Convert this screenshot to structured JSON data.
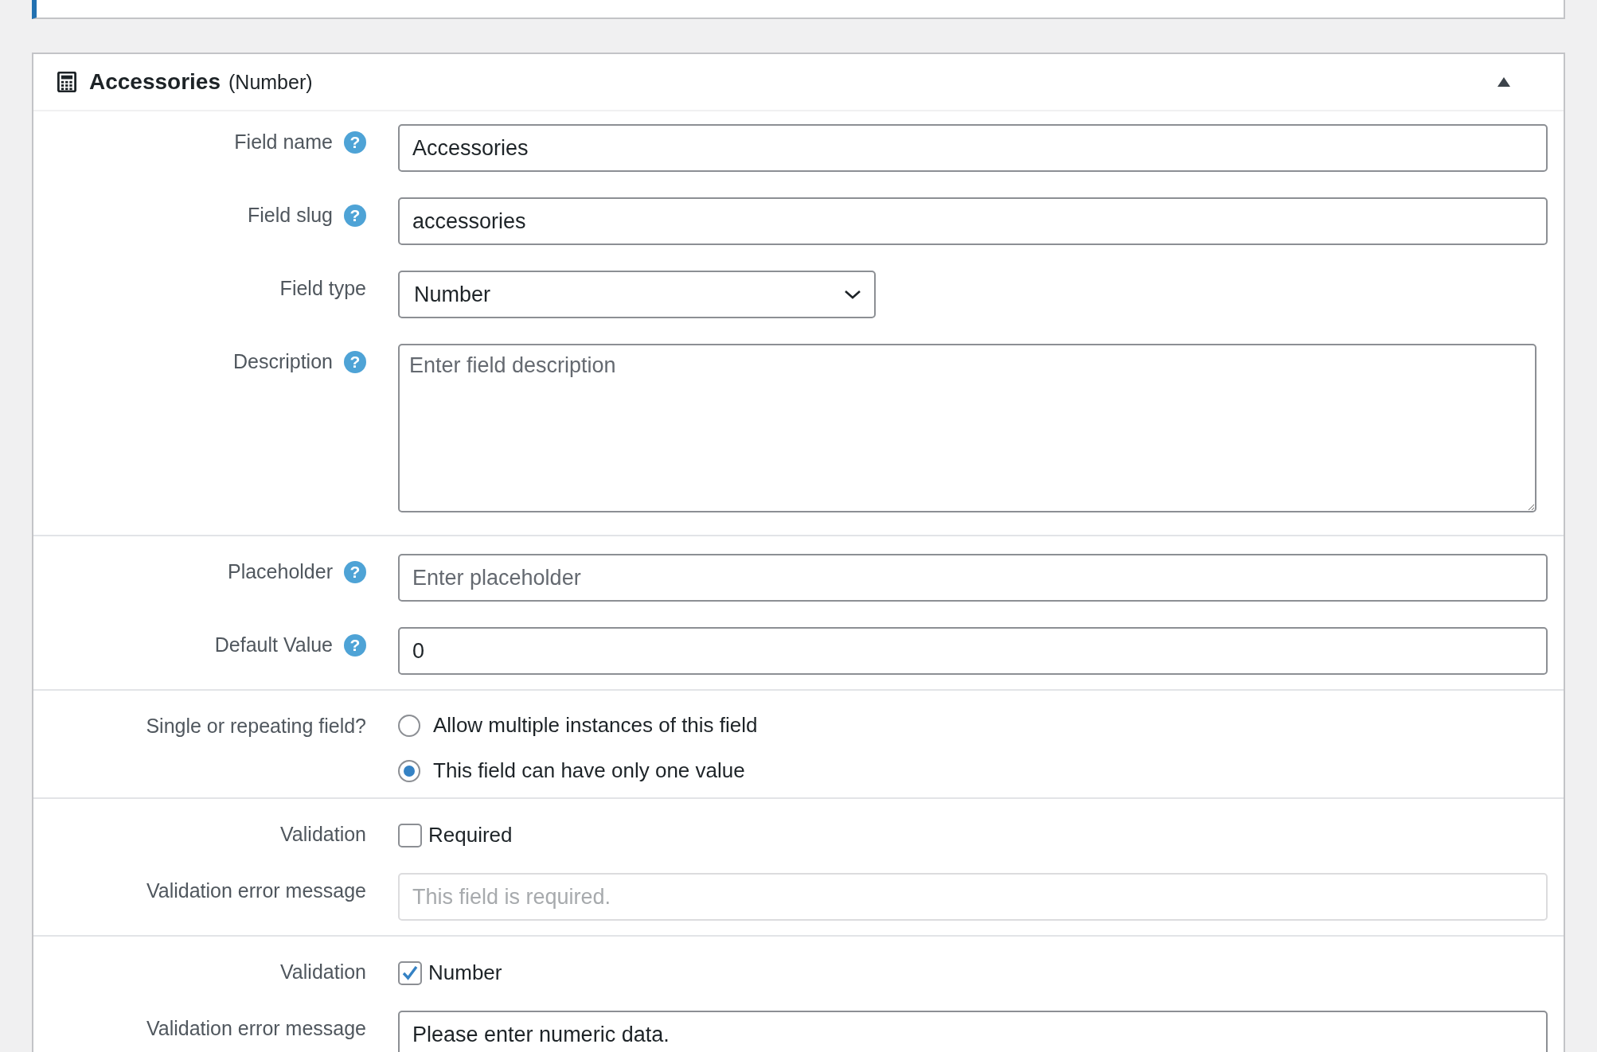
{
  "panel": {
    "title": "Accessories",
    "type_label": "(Number)",
    "expanded": true
  },
  "sections": [
    {
      "rows": [
        {
          "kind": "text",
          "label": "Field name",
          "help": "?",
          "value": "Accessories"
        },
        {
          "kind": "text",
          "label": "Field slug",
          "help": "?",
          "value": "accessories"
        },
        {
          "kind": "select",
          "label": "Field type",
          "value": "Number"
        },
        {
          "kind": "textarea",
          "label": "Description",
          "help": "?",
          "placeholder": "Enter field description"
        }
      ]
    },
    {
      "rows": [
        {
          "kind": "text",
          "label": "Placeholder",
          "help": "?",
          "placeholder": "Enter placeholder"
        },
        {
          "kind": "text",
          "label": "Default Value",
          "help": "?",
          "value": "0"
        }
      ]
    },
    {
      "rows": [
        {
          "kind": "radio",
          "label": "Single or repeating field?",
          "options": [
            {
              "label": "Allow multiple instances of this field",
              "selected": false
            },
            {
              "label": "This field can have only one value",
              "selected": true
            }
          ]
        }
      ]
    },
    {
      "rows": [
        {
          "kind": "checkbox",
          "label": "Validation",
          "option": {
            "label": "Required",
            "checked": false
          }
        },
        {
          "kind": "text",
          "label": "Validation error message",
          "value": "This field is required.",
          "disabled": true
        }
      ]
    },
    {
      "rows": [
        {
          "kind": "checkbox",
          "label": "Validation",
          "option": {
            "label": "Number",
            "checked": true
          }
        },
        {
          "kind": "text",
          "label": "Validation error message",
          "value": "Please enter numeric data."
        }
      ]
    }
  ]
}
